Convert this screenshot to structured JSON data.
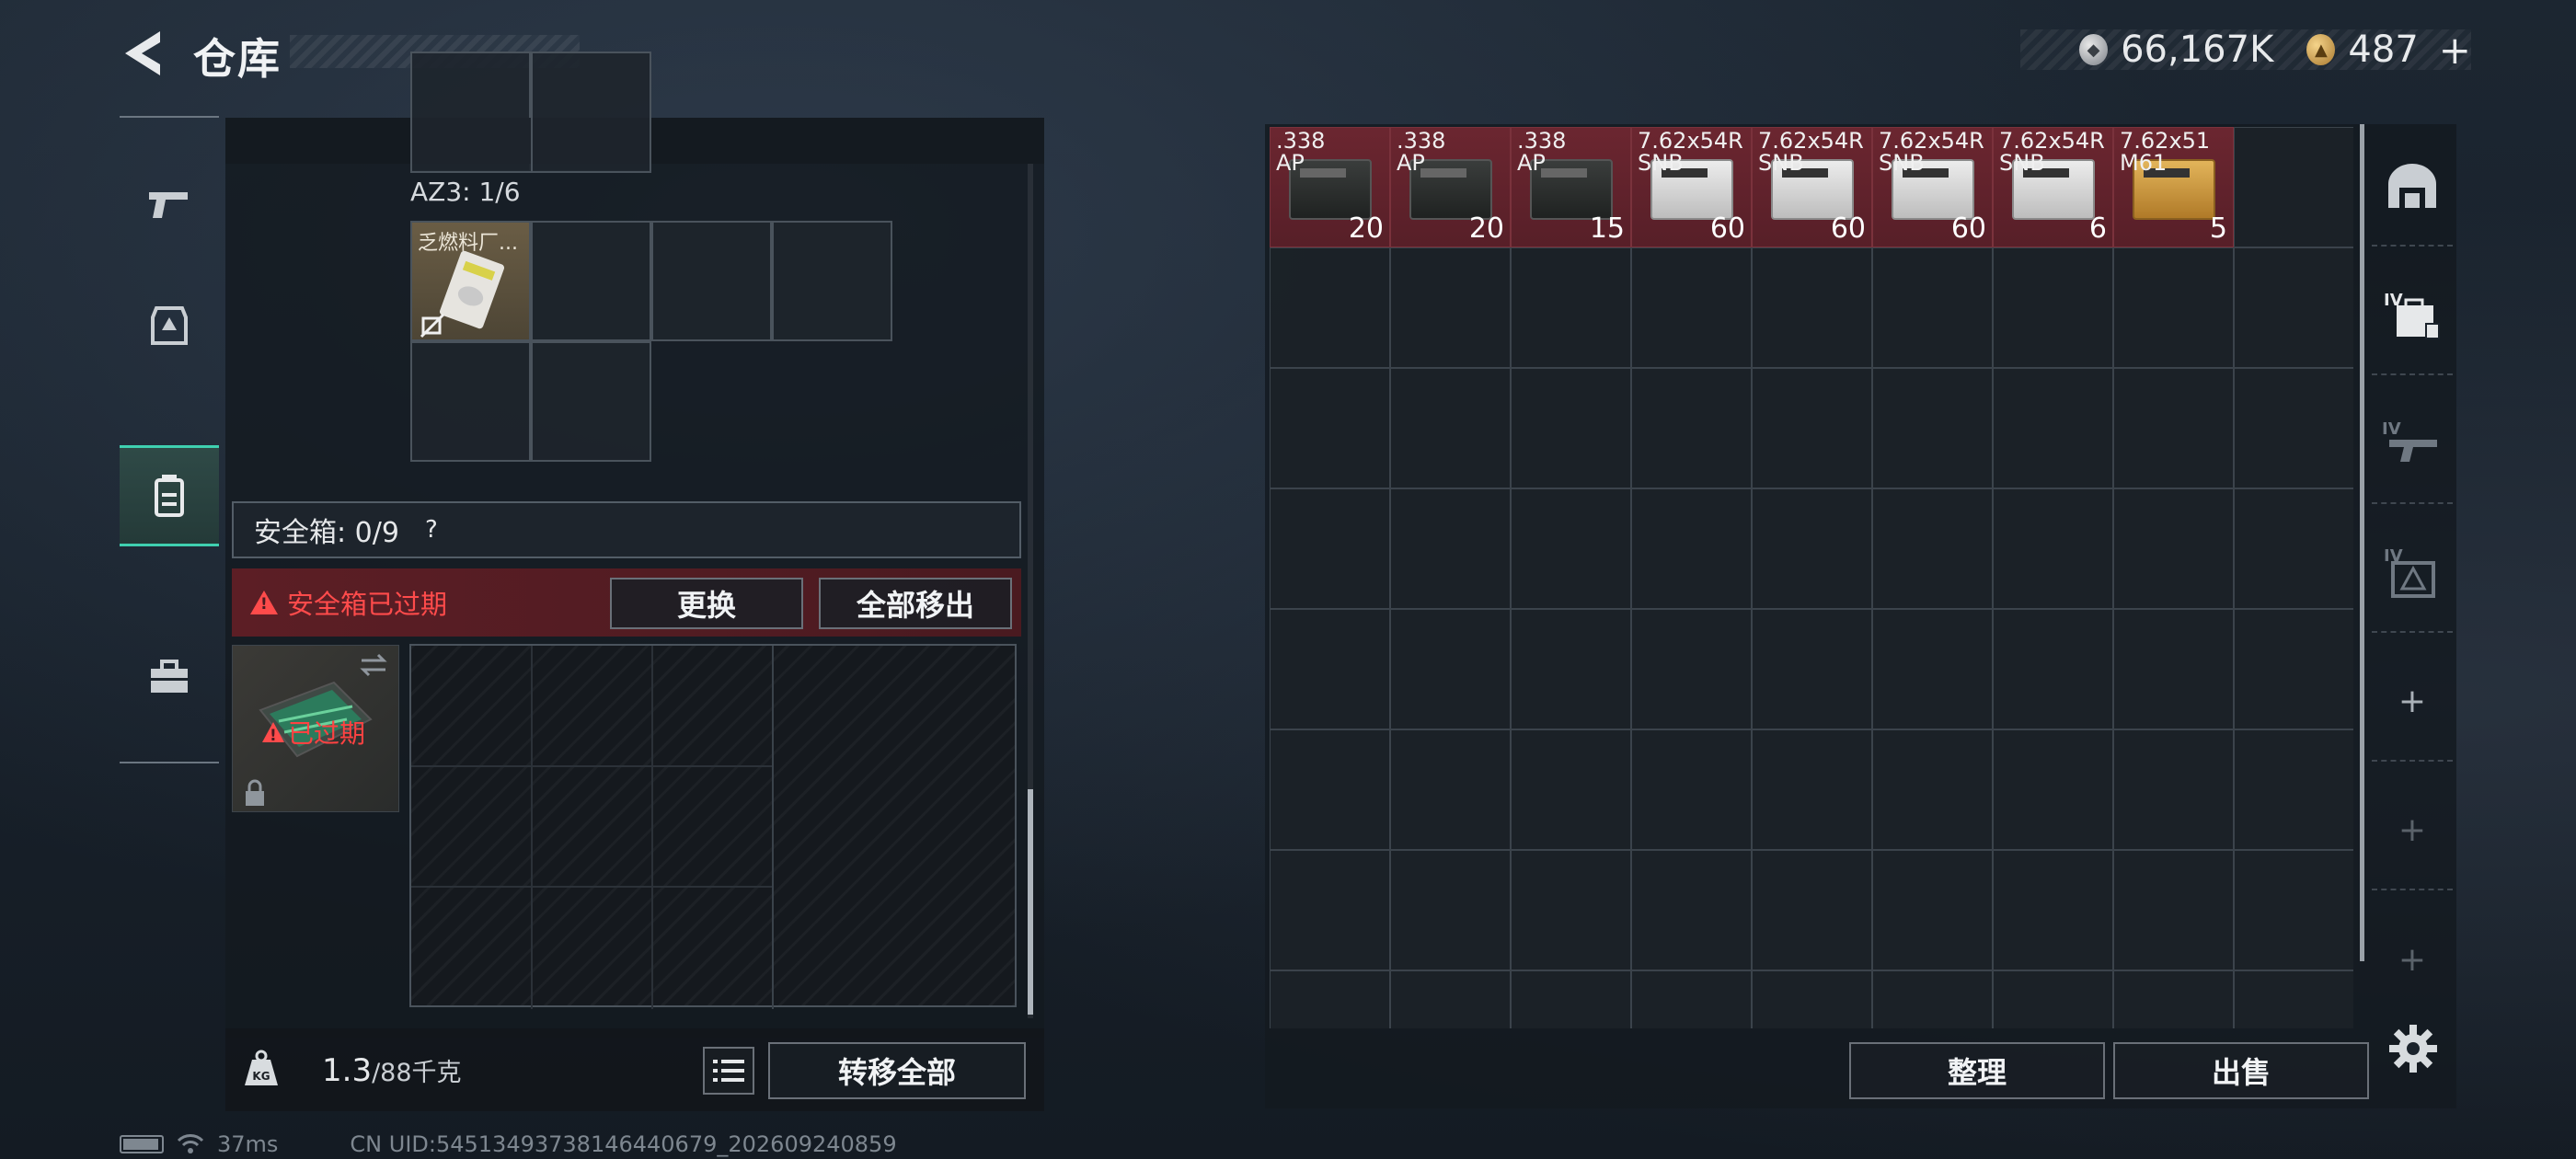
{
  "header": {
    "title": "仓库",
    "currency": [
      {
        "icon": "silver-coin-icon",
        "value": "66,167K"
      },
      {
        "icon": "gold-coin-icon",
        "value": "487"
      }
    ],
    "add_label": "+"
  },
  "left_nav": {
    "items": [
      {
        "icon": "pistol-icon",
        "active": false
      },
      {
        "icon": "helmet-icon",
        "active": false
      },
      {
        "icon": "backpack-icon",
        "active": true
      },
      {
        "icon": "toolbox-icon",
        "active": false
      }
    ]
  },
  "backpack": {
    "az3_label": "AZ3: 1/6",
    "item_label": "乏燃料厂..."
  },
  "safe_box": {
    "title": "安全箱:  0/9",
    "help": "?",
    "expired_message": "安全箱已过期",
    "replace_button": "更换",
    "move_all_button": "全部移出",
    "thumb_status": "已过期"
  },
  "weight": {
    "current": "1.3",
    "max": "/88千克"
  },
  "transfer_all_button": "转移全部",
  "stash": {
    "items": [
      {
        "name": ".338\nAP",
        "count": "20",
        "box": "dark"
      },
      {
        "name": ".338\nAP",
        "count": "20",
        "box": "dark"
      },
      {
        "name": ".338\nAP",
        "count": "15",
        "box": "dark"
      },
      {
        "name": "7.62x54R\nSNB",
        "count": "60",
        "box": "white"
      },
      {
        "name": "7.62x54R\nSNB",
        "count": "60",
        "box": "white"
      },
      {
        "name": "7.62x54R\nSNB",
        "count": "60",
        "box": "white"
      },
      {
        "name": "7.62x54R\nSNB",
        "count": "6",
        "box": "white"
      },
      {
        "name": "7.62x51\nM61",
        "count": "5",
        "box": "gold"
      }
    ],
    "sort_button": "整理",
    "sell_button": "出售"
  },
  "right_nav": {
    "items": [
      {
        "icon": "stash-icon"
      },
      {
        "icon": "case-iv-icon"
      },
      {
        "icon": "weapon-case-iv-icon"
      },
      {
        "icon": "ammo-case-iv-icon"
      },
      {
        "icon": "add-icon"
      },
      {
        "icon": "add-icon"
      },
      {
        "icon": "add-icon"
      }
    ]
  },
  "status_bar": {
    "ping": "37ms",
    "uid": "CN UID:54513493738146440679_202609240859"
  }
}
